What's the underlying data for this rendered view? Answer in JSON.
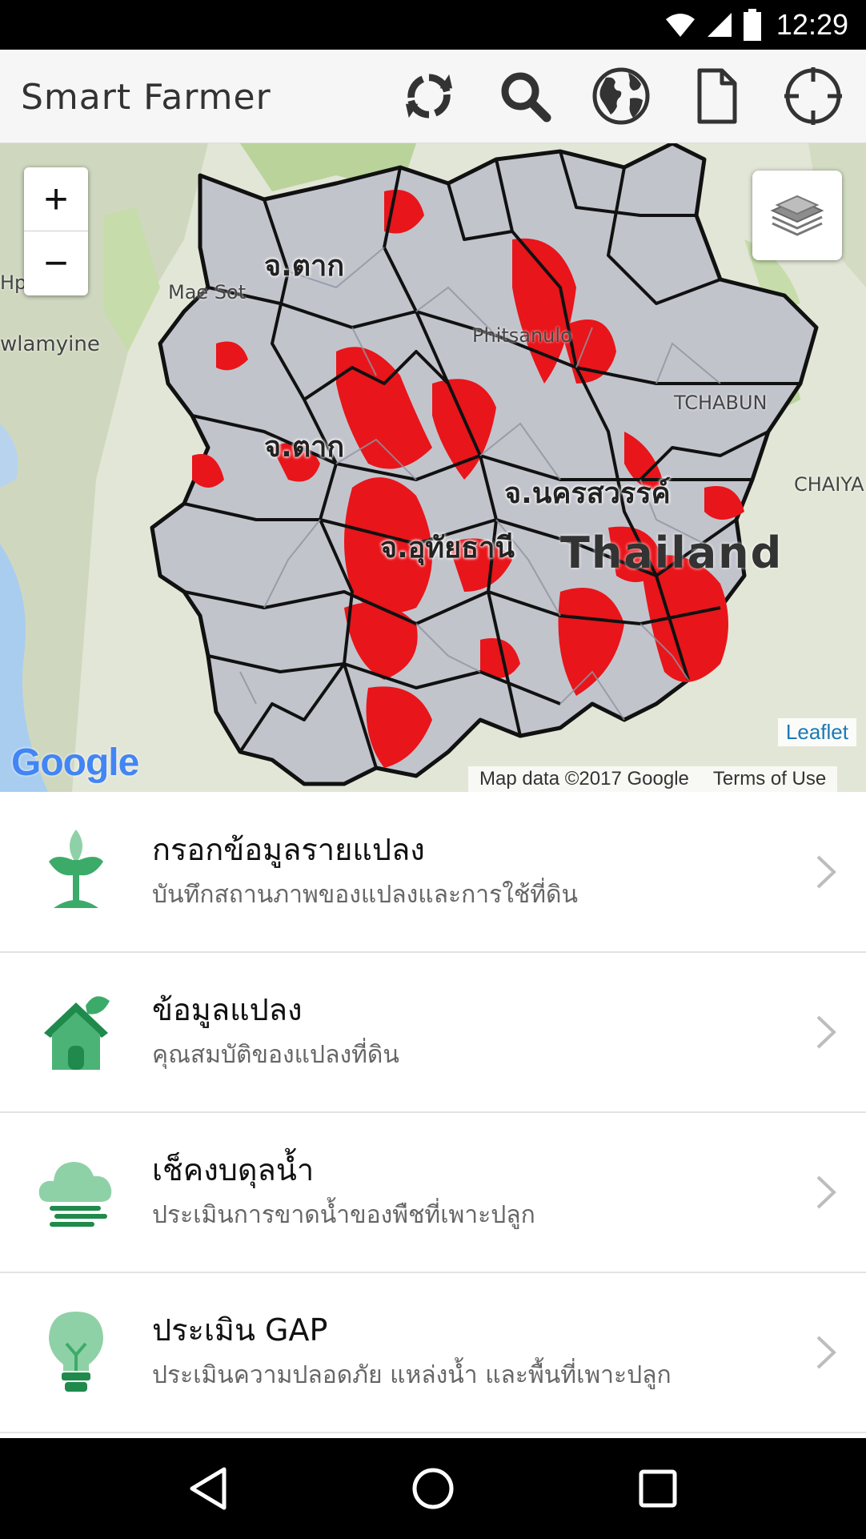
{
  "status": {
    "time": "12:29"
  },
  "app": {
    "title": "Smart Farmer"
  },
  "actions": [
    {
      "icon": "sync-icon"
    },
    {
      "icon": "search-icon"
    },
    {
      "icon": "globe-icon"
    },
    {
      "icon": "document-icon"
    },
    {
      "icon": "crosshair-icon"
    }
  ],
  "map": {
    "zoom_in": "+",
    "zoom_out": "−",
    "labels": {
      "tak_north": "จ.ตาก",
      "tak_south": "จ.ตาก",
      "nakhon_sawan": "จ.นครสวรรค์",
      "uthai_thani": "จ.อุทัยธานี",
      "thailand": "Thailand",
      "hpa_an": "Hpa-An",
      "mawlamyine": "wlamyine",
      "mae_sot": "Mae Sot",
      "phitsanulok": "Phitsanulo",
      "phetchabun": "TCHABUN",
      "chaiya": "CHAIYA"
    },
    "leaflet": "Leaflet",
    "map_data": "Map data ©2017 Google",
    "terms": "Terms of Use",
    "google": "Google"
  },
  "menu": [
    {
      "title": "กรอกข้อมูลรายแปลง",
      "subtitle": "บันทึกสถานภาพของแปลงและการใช้ที่ดิน",
      "icon": "plant-icon"
    },
    {
      "title": "ข้อมูลแปลง",
      "subtitle": "คุณสมบัติของแปลงที่ดิน",
      "icon": "house-icon"
    },
    {
      "title": "เช็คงบดุลน้ำ",
      "subtitle": "ประเมินการขาดน้ำของพืชที่เพาะปลูก",
      "icon": "cloud-wind-icon"
    },
    {
      "title": "ประเมิน GAP",
      "subtitle": "ประเมินความปลอดภัย แหล่งน้ำ และพื้นที่เพาะปลูก",
      "icon": "lightbulb-icon"
    }
  ],
  "colors": {
    "accent_green": "#3cab6a",
    "light_green": "#8fd1a7",
    "risk_red": "#e8151b",
    "boundary": "#111111"
  }
}
